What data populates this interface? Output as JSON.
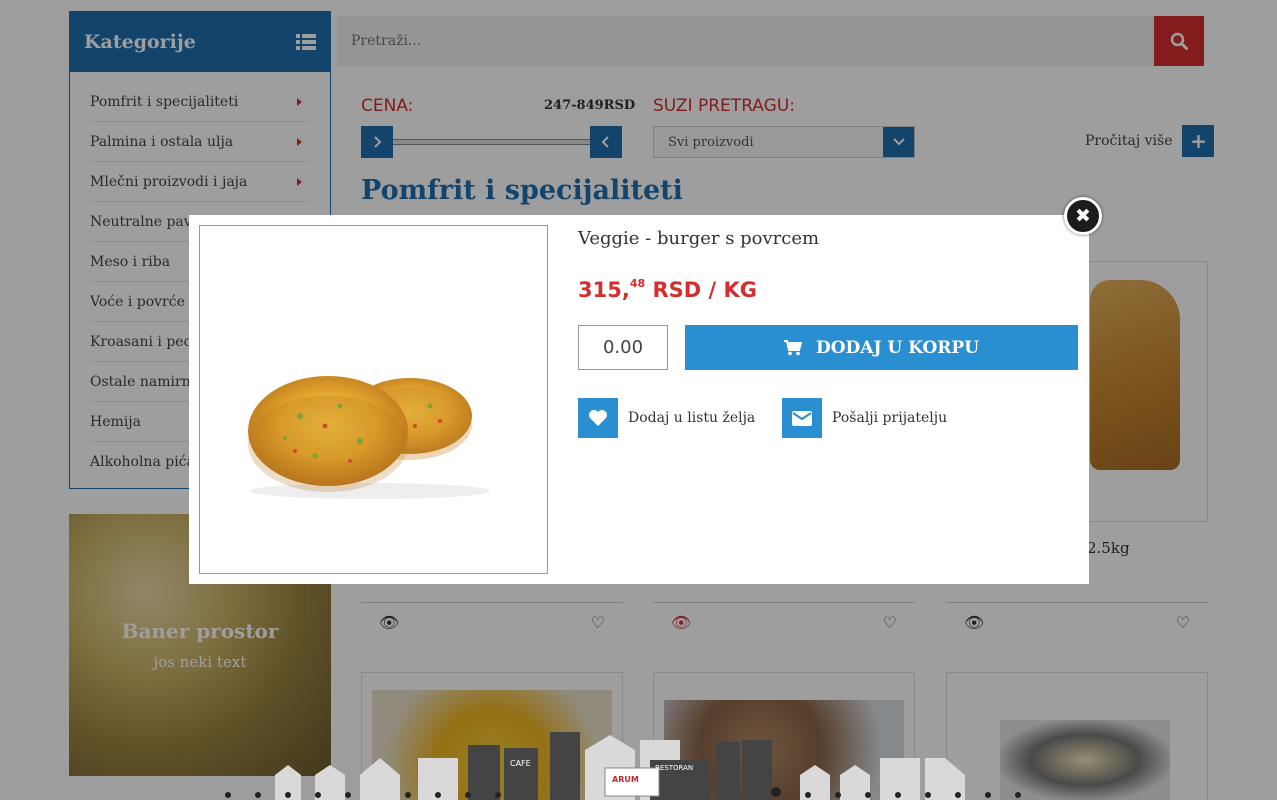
{
  "sidebar": {
    "title": "Kategorije",
    "items": [
      {
        "label": "Pomfrit i specijaliteti"
      },
      {
        "label": "Palmina i ostala ulja"
      },
      {
        "label": "Mlečni proizvodi i jaja"
      },
      {
        "label": "Neutralne pavl"
      },
      {
        "label": "Meso i riba"
      },
      {
        "label": "Voće i povrće"
      },
      {
        "label": "Kroasani i peci"
      },
      {
        "label": "Ostale namirni"
      },
      {
        "label": "Hemija"
      },
      {
        "label": "Alkoholna pića"
      }
    ]
  },
  "banner": {
    "title": "Baner prostor",
    "subtitle": "jos neki text"
  },
  "search": {
    "placeholder": "Pretraži..."
  },
  "filters": {
    "price_label": "CENA:",
    "price_range": "247-849RSD",
    "narrow_label": "SUZI PRETRAGU:",
    "select_value": "Svi proizvodi",
    "read_more": "Pročitaj više"
  },
  "page_title": "Pomfrit i specijaliteti",
  "products_background": {
    "partial_name_right": "2.5kg"
  },
  "modal": {
    "title": "Veggie - burger s povrcem",
    "price_main": "315,",
    "price_decimals": "48",
    "price_unit": " RSD / KG",
    "quantity": "0.00",
    "add_to_cart": "DODAJ U KORPU",
    "wishlist": "Dodaj u listu želja",
    "send_friend": "Pošalji prijatelju",
    "close_symbol": "✖"
  },
  "colors": {
    "brand_blue": "#1d6fae",
    "button_blue": "#2a8fd1",
    "accent_red": "#d32f2f"
  },
  "city_labels": [
    "CAFE",
    "ARUM",
    "RESTORAN"
  ]
}
